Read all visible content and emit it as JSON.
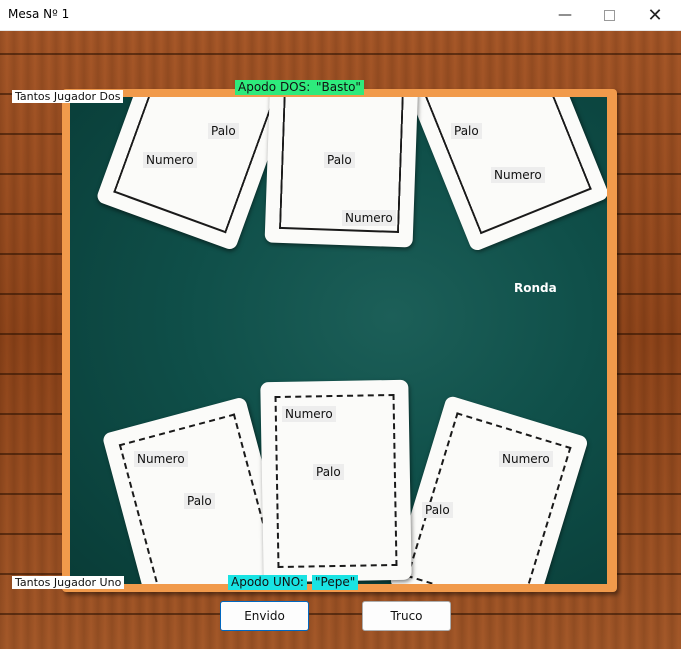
{
  "window": {
    "title": "Mesa Nº 1",
    "minimize_icon": "minimize-icon",
    "maximize_icon": "maximize-icon",
    "close_icon": "close-icon"
  },
  "colors": {
    "apodo_dos_bg": "#2eea7c",
    "apodo_uno_bg": "#19e3e3",
    "table_border": "#f19a4b",
    "felt": "#0f4f49"
  },
  "player_two": {
    "score_label": "Tantos Jugador Dos",
    "nickname_label": "Apodo DOS:",
    "nickname_value": "\"Basto\"",
    "cards": [
      {
        "palo": "Palo",
        "numero": "Numero"
      },
      {
        "palo": "Palo",
        "numero": "Numero"
      },
      {
        "palo": "Palo",
        "numero": "Numero"
      }
    ]
  },
  "player_one": {
    "score_label": "Tantos Jugador Uno",
    "nickname_label": "Apodo UNO:",
    "nickname_value": "\"Pepe\"",
    "cards": [
      {
        "palo": "Palo",
        "numero": "Numero"
      },
      {
        "palo": "Palo",
        "numero": "Numero"
      },
      {
        "palo": "Palo",
        "numero": "Numero"
      }
    ]
  },
  "round_label": "Ronda",
  "actions": {
    "envido": "Envido",
    "truco": "Truco"
  }
}
